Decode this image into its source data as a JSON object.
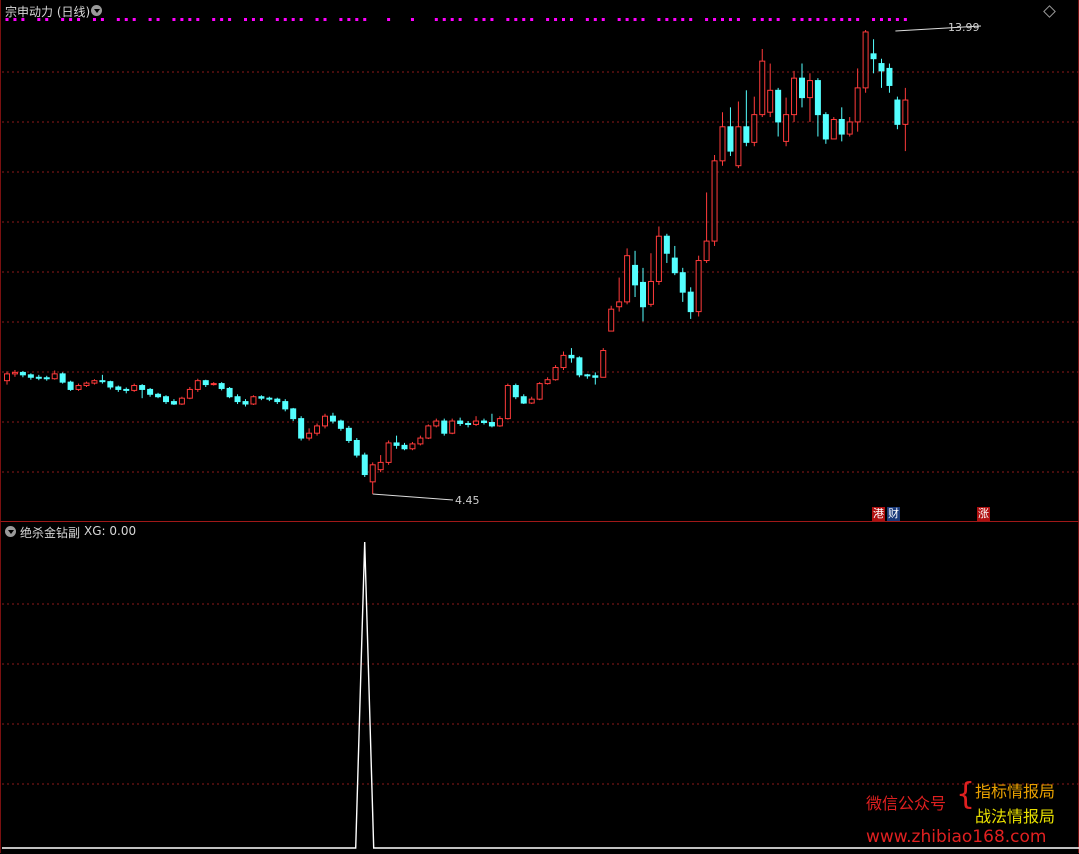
{
  "main_panel": {
    "title": "宗申动力 (日线)",
    "high_label": "13.99",
    "low_label": "4.45",
    "tags": [
      "港",
      "财",
      "涨"
    ],
    "colors": {
      "up": "#ff3b3b",
      "down": "#54ffff",
      "grid": "#8b1a1a",
      "signal": "#ff00ff"
    }
  },
  "sub_panel": {
    "title": "绝杀金钻副",
    "indicator_label": "XG: 0.00"
  },
  "watermark": {
    "left": "微信公众号",
    "right_top": "指标情报局",
    "right_bottom": "战法情报局",
    "url": "www.zhibiao168.com"
  },
  "chart_data": {
    "type": "candlestick",
    "price_low": 4.45,
    "price_high": 13.99,
    "candles": [
      [
        6.78,
        6.92,
        6.97,
        6.7
      ],
      [
        6.92,
        6.95,
        7.0,
        6.86
      ],
      [
        6.95,
        6.9,
        6.98,
        6.85
      ],
      [
        6.9,
        6.85,
        6.93,
        6.8
      ],
      [
        6.85,
        6.84,
        6.9,
        6.79
      ],
      [
        6.84,
        6.82,
        6.88,
        6.78
      ],
      [
        6.82,
        6.92,
        6.99,
        6.8
      ],
      [
        6.92,
        6.75,
        6.95,
        6.72
      ],
      [
        6.75,
        6.6,
        6.78,
        6.57
      ],
      [
        6.6,
        6.68,
        6.72,
        6.57
      ],
      [
        6.68,
        6.73,
        6.76,
        6.65
      ],
      [
        6.73,
        6.78,
        6.81,
        6.7
      ],
      [
        6.78,
        6.76,
        6.9,
        6.72
      ],
      [
        6.76,
        6.65,
        6.78,
        6.6
      ],
      [
        6.65,
        6.6,
        6.68,
        6.55
      ],
      [
        6.6,
        6.58,
        6.64,
        6.52
      ],
      [
        6.58,
        6.68,
        6.72,
        6.55
      ],
      [
        6.68,
        6.6,
        6.71,
        6.42
      ],
      [
        6.6,
        6.5,
        6.63,
        6.45
      ],
      [
        6.5,
        6.45,
        6.53,
        6.42
      ],
      [
        6.45,
        6.35,
        6.48,
        6.3
      ],
      [
        6.35,
        6.3,
        6.4,
        6.28
      ],
      [
        6.3,
        6.42,
        6.45,
        6.28
      ],
      [
        6.42,
        6.6,
        6.65,
        6.4
      ],
      [
        6.6,
        6.78,
        6.82,
        6.55
      ],
      [
        6.78,
        6.7,
        6.8,
        6.65
      ],
      [
        6.7,
        6.72,
        6.75,
        6.68
      ],
      [
        6.72,
        6.62,
        6.75,
        6.58
      ],
      [
        6.62,
        6.45,
        6.65,
        6.42
      ],
      [
        6.45,
        6.35,
        6.5,
        6.3
      ],
      [
        6.35,
        6.3,
        6.4,
        6.25
      ],
      [
        6.3,
        6.45,
        6.48,
        6.28
      ],
      [
        6.45,
        6.42,
        6.48,
        6.38
      ],
      [
        6.42,
        6.4,
        6.45,
        6.36
      ],
      [
        6.4,
        6.35,
        6.43,
        6.3
      ],
      [
        6.35,
        6.2,
        6.4,
        6.15
      ],
      [
        6.2,
        6.0,
        6.22,
        5.95
      ],
      [
        6.0,
        5.6,
        6.05,
        5.55
      ],
      [
        5.6,
        5.7,
        5.8,
        5.55
      ],
      [
        5.7,
        5.85,
        5.9,
        5.65
      ],
      [
        5.85,
        6.05,
        6.1,
        5.8
      ],
      [
        6.05,
        5.95,
        6.12,
        5.9
      ],
      [
        5.95,
        5.8,
        5.98,
        5.75
      ],
      [
        5.8,
        5.55,
        5.85,
        5.5
      ],
      [
        5.55,
        5.25,
        5.6,
        5.2
      ],
      [
        5.25,
        4.85,
        5.3,
        4.8
      ],
      [
        4.7,
        5.05,
        5.1,
        4.45
      ],
      [
        4.95,
        5.1,
        5.25,
        4.9
      ],
      [
        5.1,
        5.5,
        5.55,
        5.05
      ],
      [
        5.5,
        5.45,
        5.65,
        5.38
      ],
      [
        5.45,
        5.38,
        5.5,
        5.35
      ],
      [
        5.38,
        5.48,
        5.52,
        5.35
      ],
      [
        5.48,
        5.6,
        5.65,
        5.45
      ],
      [
        5.6,
        5.85,
        5.88,
        5.58
      ],
      [
        5.85,
        5.95,
        6.0,
        5.82
      ],
      [
        5.95,
        5.7,
        6.0,
        5.65
      ],
      [
        5.7,
        5.95,
        6.0,
        5.68
      ],
      [
        5.95,
        5.9,
        6.02,
        5.85
      ],
      [
        5.9,
        5.88,
        5.95,
        5.82
      ],
      [
        5.88,
        5.95,
        6.05,
        5.85
      ],
      [
        5.95,
        5.92,
        6.0,
        5.88
      ],
      [
        5.92,
        5.85,
        6.1,
        5.82
      ],
      [
        5.85,
        6.0,
        6.05,
        5.83
      ],
      [
        6.0,
        6.68,
        6.72,
        5.98
      ],
      [
        6.68,
        6.45,
        6.72,
        6.4
      ],
      [
        6.45,
        6.32,
        6.5,
        6.3
      ],
      [
        6.32,
        6.4,
        6.45,
        6.3
      ],
      [
        6.4,
        6.72,
        6.75,
        6.38
      ],
      [
        6.72,
        6.8,
        6.85,
        6.7
      ],
      [
        6.8,
        7.05,
        7.1,
        6.78
      ],
      [
        7.05,
        7.3,
        7.38,
        7.0
      ],
      [
        7.3,
        7.25,
        7.45,
        7.15
      ],
      [
        7.25,
        6.9,
        7.28,
        6.85
      ],
      [
        6.9,
        6.88,
        6.92,
        6.82
      ],
      [
        6.88,
        6.85,
        6.95,
        6.7
      ],
      [
        6.85,
        7.4,
        7.45,
        6.85
      ],
      [
        7.8,
        8.25,
        8.32,
        7.8
      ],
      [
        8.3,
        8.4,
        8.9,
        8.2
      ],
      [
        8.4,
        9.35,
        9.5,
        8.35
      ],
      [
        9.15,
        8.75,
        9.45,
        8.5
      ],
      [
        8.8,
        8.3,
        9.1,
        8.0
      ],
      [
        8.35,
        8.82,
        9.4,
        8.3
      ],
      [
        8.82,
        9.75,
        9.95,
        8.75
      ],
      [
        9.75,
        9.4,
        9.8,
        9.2
      ],
      [
        9.3,
        9.0,
        9.55,
        8.95
      ],
      [
        9.0,
        8.6,
        9.1,
        8.4
      ],
      [
        8.6,
        8.2,
        8.7,
        8.05
      ],
      [
        8.2,
        9.25,
        9.35,
        8.1
      ],
      [
        9.25,
        9.65,
        10.65,
        9.2
      ],
      [
        9.65,
        11.3,
        11.42,
        9.55
      ],
      [
        11.3,
        12.0,
        12.3,
        11.2
      ],
      [
        12.0,
        11.5,
        12.4,
        11.4
      ],
      [
        11.2,
        12.0,
        12.52,
        11.15
      ],
      [
        12.0,
        11.68,
        12.75,
        11.6
      ],
      [
        11.68,
        12.25,
        12.62,
        11.6
      ],
      [
        12.25,
        13.35,
        13.6,
        12.2
      ],
      [
        12.3,
        12.75,
        13.3,
        12.2
      ],
      [
        12.75,
        12.1,
        12.8,
        11.8
      ],
      [
        11.7,
        12.25,
        12.6,
        11.6
      ],
      [
        12.25,
        13.0,
        13.15,
        12.1
      ],
      [
        13.0,
        12.6,
        13.3,
        12.4
      ],
      [
        12.6,
        12.95,
        13.1,
        12.1
      ],
      [
        12.95,
        12.25,
        13.0,
        11.8
      ],
      [
        12.25,
        11.75,
        12.3,
        11.65
      ],
      [
        11.75,
        12.15,
        12.2,
        11.8
      ],
      [
        12.15,
        11.85,
        12.4,
        11.7
      ],
      [
        11.85,
        12.1,
        12.2,
        11.8
      ],
      [
        12.1,
        12.8,
        13.2,
        11.9
      ],
      [
        12.8,
        13.95,
        13.99,
        12.7
      ],
      [
        13.5,
        13.4,
        13.8,
        13.1
      ],
      [
        13.3,
        13.15,
        13.4,
        12.8
      ],
      [
        13.2,
        12.85,
        13.3,
        12.7
      ],
      [
        12.55,
        12.05,
        12.62,
        11.95
      ],
      [
        12.05,
        12.55,
        12.8,
        11.5
      ]
    ],
    "signal_dots_row": true,
    "sub_indicator": {
      "name": "XG",
      "current": 0.0,
      "spike_index": 46,
      "spike_value": 1
    }
  }
}
